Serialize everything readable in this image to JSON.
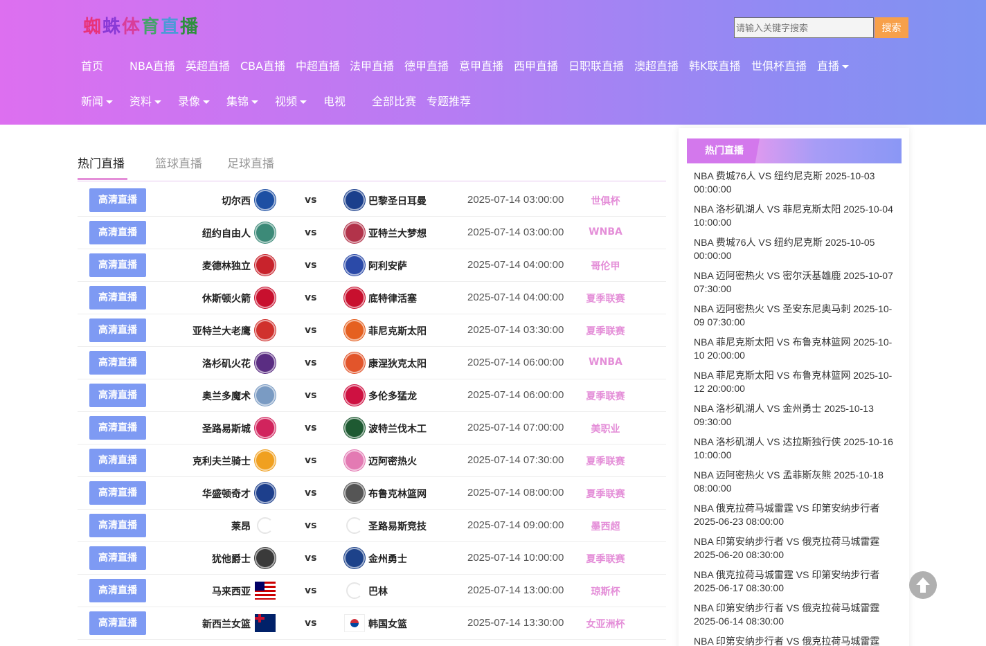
{
  "header": {
    "logo_chars": [
      {
        "ch": "蜘",
        "color": "#e8337a"
      },
      {
        "ch": "蛛",
        "color": "#8a3ad6"
      },
      {
        "ch": "体",
        "color": "#d83e9a"
      },
      {
        "ch": "育",
        "color": "#44a36a"
      },
      {
        "ch": "直",
        "color": "#4c9ad6"
      },
      {
        "ch": "播",
        "color": "#2f8f3e"
      }
    ],
    "search_placeholder": "请输入关键字搜索",
    "search_button": "搜索",
    "nav_row1": [
      "首页",
      "NBA直播",
      "英超直播",
      "CBA直播",
      "中超直播",
      "法甲直播",
      "德甲直播",
      "意甲直播",
      "西甲直播",
      "日职联直播",
      "澳超直播",
      "韩K联直播",
      "世俱杯直播",
      "直播"
    ],
    "nav_row2": [
      "新闻",
      "资料",
      "录像",
      "集锦",
      "视频",
      "电视",
      "全部比赛",
      "专题推荐"
    ]
  },
  "tabs": [
    "热门直播",
    "篮球直播",
    "足球直播"
  ],
  "live_button_label": "高清直播",
  "vs_label": "vs",
  "matches": [
    {
      "home": "切尔西",
      "away": "巴黎圣日耳曼",
      "time": "2025-07-14 03:00:00",
      "league": "世俱杯",
      "home_logo": "chelsea-logo",
      "home_color": "#1d4fa3",
      "away_logo": "psg-logo",
      "away_color": "#1b3f8c"
    },
    {
      "home": "纽约自由人",
      "away": "亚特兰大梦想",
      "time": "2025-07-14 03:00:00",
      "league": "WNBA",
      "home_logo": "liberty-logo",
      "home_color": "#3c8a78",
      "away_logo": "dream-logo",
      "away_color": "#b2334a"
    },
    {
      "home": "麦德林独立",
      "away": "阿利安萨",
      "time": "2025-07-14 04:00:00",
      "league": "哥伦甲",
      "home_logo": "medellin-logo",
      "home_color": "#c8232c",
      "away_logo": "alianza-logo",
      "away_color": "#2b4aa8"
    },
    {
      "home": "休斯顿火箭",
      "away": "底特律活塞",
      "time": "2025-07-14 04:00:00",
      "league": "夏季联赛",
      "home_logo": "rockets-logo",
      "home_color": "#c8102e",
      "away_logo": "pistons-logo",
      "away_color": "#c8102e"
    },
    {
      "home": "亚特兰大老鹰",
      "away": "菲尼克斯太阳",
      "time": "2025-07-14 03:30:00",
      "league": "夏季联赛",
      "home_logo": "hawks-logo",
      "home_color": "#d0312d",
      "away_logo": "suns-logo",
      "away_color": "#e56020"
    },
    {
      "home": "洛杉矶火花",
      "away": "康涅狄克太阳",
      "time": "2025-07-14 06:00:00",
      "league": "WNBA",
      "home_logo": "sparks-logo",
      "home_color": "#5a2d82",
      "away_logo": "sun-logo",
      "away_color": "#e2552b"
    },
    {
      "home": "奥兰多魔术",
      "away": "多伦多猛龙",
      "time": "2025-07-14 06:00:00",
      "league": "夏季联赛",
      "home_logo": "magic-logo",
      "home_color": "#7a9bc3",
      "away_logo": "raptors-logo",
      "away_color": "#ce1141"
    },
    {
      "home": "圣路易斯城",
      "away": "波特兰伐木工",
      "time": "2025-07-14 07:00:00",
      "league": "美职业",
      "home_logo": "stlcity-logo",
      "home_color": "#d1245d",
      "away_logo": "timbers-logo",
      "away_color": "#1e5a32"
    },
    {
      "home": "克利夫兰骑士",
      "away": "迈阿密热火",
      "time": "2025-07-14 07:30:00",
      "league": "夏季联赛",
      "home_logo": "cavaliers-logo",
      "home_color": "#f0a020",
      "away_logo": "heat-logo",
      "away_color": "#e37ab3"
    },
    {
      "home": "华盛顿奇才",
      "away": "布鲁克林篮网",
      "time": "2025-07-14 08:00:00",
      "league": "夏季联赛",
      "home_logo": "wizards-logo",
      "home_color": "#1d3f8c",
      "away_logo": "nets-logo",
      "away_color": "#555555"
    },
    {
      "home": "莱昂",
      "away": "圣路易斯竞技",
      "time": "2025-07-14 09:00:00",
      "league": "墨西超",
      "home_logo": "loading-icon",
      "home_color": "#e6e6e6",
      "away_logo": "loading-icon",
      "away_color": "#e6e6e6"
    },
    {
      "home": "犹他爵士",
      "away": "金州勇士",
      "time": "2025-07-14 10:00:00",
      "league": "夏季联赛",
      "home_logo": "jazz-logo",
      "home_color": "#3a3a3a",
      "away_logo": "warriors-logo",
      "away_color": "#1d428a"
    },
    {
      "home": "马来西亚",
      "away": "巴林",
      "time": "2025-07-14 13:00:00",
      "league": "琼斯杯",
      "home_logo": "malaysia-flag",
      "home_color": "#cc0001",
      "away_logo": "loading-icon",
      "away_color": "#e6e6e6"
    },
    {
      "home": "新西兰女篮",
      "away": "韩国女篮",
      "time": "2025-07-14 13:30:00",
      "league": "女亚洲杯",
      "home_logo": "newzealand-flag",
      "home_color": "#012169",
      "away_logo": "korea-flag",
      "away_color": "#ffffff"
    }
  ],
  "sidebar": {
    "title": "热门直播",
    "items": [
      "NBA 费城76人 VS 纽约尼克斯 2025-10-03 00:00:00",
      "NBA 洛杉矶湖人 VS 菲尼克斯太阳 2025-10-04 10:00:00",
      "NBA 费城76人 VS 纽约尼克斯 2025-10-05 00:00:00",
      "NBA 迈阿密热火 VS 密尔沃基雄鹿 2025-10-07 07:30:00",
      "NBA 迈阿密热火 VS 圣安东尼奥马刺 2025-10-09 07:30:00",
      "NBA 菲尼克斯太阳 VS 布鲁克林篮网 2025-10-10 20:00:00",
      "NBA 菲尼克斯太阳 VS 布鲁克林篮网 2025-10-12 20:00:00",
      "NBA 洛杉矶湖人 VS 金州勇士 2025-10-13 09:30:00",
      "NBA 洛杉矶湖人 VS 达拉斯独行侠 2025-10-16 10:00:00",
      "NBA 迈阿密热火 VS 孟菲斯灰熊 2025-10-18 08:00:00",
      "NBA 俄克拉荷马城雷霆 VS 印第安纳步行者 2025-06-23 08:00:00",
      "NBA 印第安纳步行者 VS 俄克拉荷马城雷霆 2025-06-20 08:30:00",
      "NBA 俄克拉荷马城雷霆 VS 印第安纳步行者 2025-06-17 08:30:00",
      "NBA 印第安纳步行者 VS 俄克拉荷马城雷霆 2025-06-14 08:30:00",
      "NBA 印第安纳步行者 VS 俄克拉荷马城雷霆"
    ]
  }
}
